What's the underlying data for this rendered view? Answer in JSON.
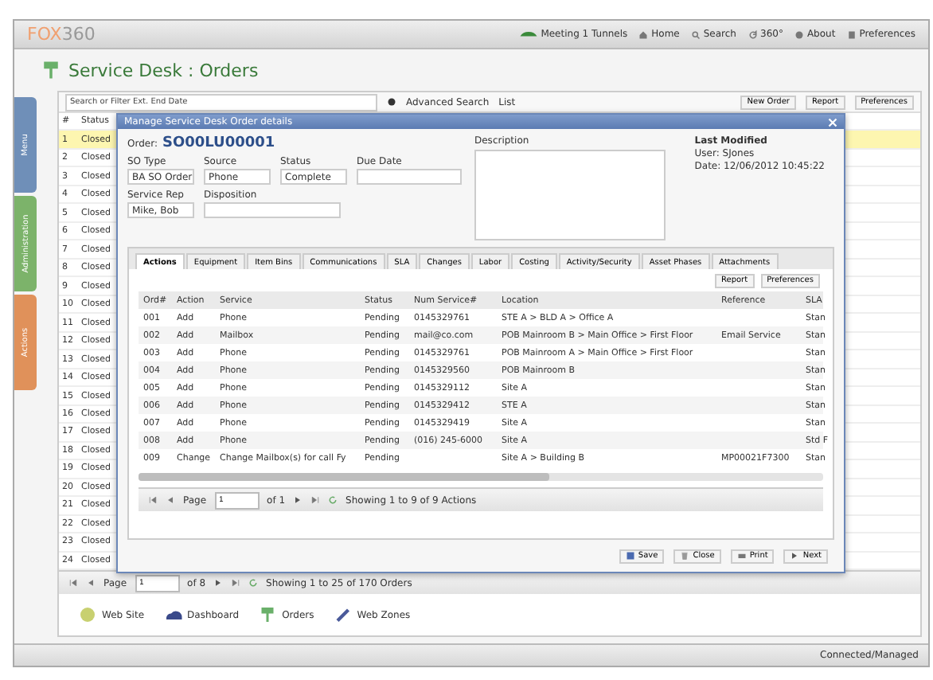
{
  "app": {
    "logo_a": "FOX",
    "logo_b": "360",
    "nav": [
      {
        "label": "Meeting 1 Tunnels"
      },
      {
        "label": "Home"
      },
      {
        "label": "Search"
      },
      {
        "label": "360°"
      },
      {
        "label": "About"
      },
      {
        "label": "Preferences"
      }
    ]
  },
  "page_title": "Service Desk : Orders",
  "side_tabs": [
    {
      "label": "Menu",
      "color": "#6f8fb8"
    },
    {
      "label": "Administration",
      "color": "#7cb36a"
    },
    {
      "label": "Actions",
      "color": "#e0915a"
    }
  ],
  "search": {
    "placeholder": "Search or Filter Ext. End Date",
    "advanced": "Advanced Search",
    "list": "List",
    "buttons": [
      "New Order",
      "Report",
      "Preferences"
    ]
  },
  "list": {
    "columns": [
      "#",
      "Status"
    ],
    "rows": [
      {
        "num": "1",
        "status": "Closed",
        "selected": true
      },
      {
        "num": "2",
        "status": "Closed",
        "selected": false
      },
      {
        "num": "3",
        "status": "Closed",
        "selected": false
      },
      {
        "num": "4",
        "status": "Closed",
        "selected": false
      },
      {
        "num": "5",
        "status": "Closed",
        "selected": false
      },
      {
        "num": "6",
        "status": "Closed",
        "selected": false
      },
      {
        "num": "7",
        "status": "Closed",
        "selected": false
      },
      {
        "num": "8",
        "status": "Closed",
        "selected": false
      },
      {
        "num": "9",
        "status": "Closed",
        "selected": false
      },
      {
        "num": "10",
        "status": "Closed",
        "selected": false
      },
      {
        "num": "11",
        "status": "Closed",
        "selected": false
      },
      {
        "num": "12",
        "status": "Closed",
        "selected": false
      },
      {
        "num": "13",
        "status": "Closed",
        "selected": false
      },
      {
        "num": "14",
        "status": "Closed",
        "selected": false
      },
      {
        "num": "15",
        "status": "Closed",
        "selected": false
      },
      {
        "num": "16",
        "status": "Closed",
        "selected": false
      },
      {
        "num": "17",
        "status": "Closed",
        "selected": false
      },
      {
        "num": "18",
        "status": "Closed",
        "selected": false
      },
      {
        "num": "19",
        "status": "Closed",
        "selected": false
      },
      {
        "num": "20",
        "status": "Closed",
        "selected": false
      },
      {
        "num": "21",
        "status": "Closed",
        "selected": false
      },
      {
        "num": "22",
        "status": "Closed",
        "selected": false
      },
      {
        "num": "23",
        "status": "Closed",
        "selected": false
      },
      {
        "num": "24",
        "status": "Closed",
        "selected": false
      }
    ],
    "pager": {
      "page_label": "Page",
      "page": "1",
      "of": "of 8",
      "info": "Showing 1 to 25 of 170 Orders"
    }
  },
  "shortcuts": [
    {
      "label": "Web Site"
    },
    {
      "label": "Dashboard"
    },
    {
      "label": "Orders"
    },
    {
      "label": "Web Zones"
    }
  ],
  "dialog": {
    "title": "Manage Service Desk Order details",
    "order_label": "Order:",
    "order_number": "SO00LU00001",
    "fields": [
      {
        "label": "SO Type",
        "value": "BA SO Order"
      },
      {
        "label": "Source",
        "value": "Phone"
      },
      {
        "label": "Status",
        "value": "Complete"
      },
      {
        "label": "Due Date"
      }
    ],
    "rep": {
      "label": "Service Rep",
      "value": "Mike, Bob"
    },
    "disposition": "Disposition",
    "description": "Description",
    "modified": {
      "title": "Last Modified",
      "user": "User: SJones",
      "date": "Date: 12/06/2012 10:45:22"
    },
    "tabs": [
      {
        "label": "Actions",
        "selected": true
      },
      {
        "label": "Equipment",
        "selected": false
      },
      {
        "label": "Item Bins",
        "selected": false
      },
      {
        "label": "Communications",
        "selected": false
      },
      {
        "label": "SLA",
        "selected": false
      },
      {
        "label": "Changes",
        "selected": false
      },
      {
        "label": "Labor",
        "selected": false
      },
      {
        "label": "Costing",
        "selected": false
      },
      {
        "label": "Activity/Security",
        "selected": false
      },
      {
        "label": "Asset Phases",
        "selected": false
      },
      {
        "label": "Attachments",
        "selected": false
      }
    ],
    "tools": [
      "Report",
      "Preferences"
    ],
    "table": {
      "columns": [
        "Ord#",
        "Action",
        "Service",
        "Status",
        "Num Service#",
        "Location",
        "Reference",
        "SLA"
      ],
      "rows": [
        [
          "001",
          "Add",
          "Phone",
          "Pending",
          "0145329761",
          "STE A > BLD A > Office A",
          "",
          "Stan"
        ],
        [
          "002",
          "Add",
          "Mailbox",
          "Pending",
          "mail@co.com",
          "POB Mainroom B > Main Office > First Floor",
          "Email Service",
          "Stan"
        ],
        [
          "003",
          "Add",
          "Phone",
          "Pending",
          "0145329761",
          "POB Mainroom A > Main Office > First Floor",
          "",
          "Stan"
        ],
        [
          "004",
          "Add",
          "Phone",
          "Pending",
          "0145329560",
          "POB Mainroom B",
          "",
          "Stan"
        ],
        [
          "005",
          "Add",
          "Phone",
          "Pending",
          "0145329112",
          "Site A",
          "",
          "Stan"
        ],
        [
          "006",
          "Add",
          "Phone",
          "Pending",
          "0145329412",
          "STE A",
          "",
          "Stan"
        ],
        [
          "007",
          "Add",
          "Phone",
          "Pending",
          "0145329419",
          "Site A",
          "",
          "Stan"
        ],
        [
          "008",
          "Add",
          "Phone",
          "Pending",
          "(016) 245-6000",
          "Site A",
          "",
          "Std F"
        ],
        [
          "009",
          "Change",
          "Change Mailbox(s) for call Fy",
          "Pending",
          "",
          "Site A > Building B",
          "MP00021F7300",
          "Stan"
        ]
      ]
    },
    "pager": {
      "page_label": "Page",
      "page": "1",
      "of": "of 1",
      "info": "Showing 1 to 9 of 9 Actions"
    },
    "buttons": [
      {
        "label": "Save"
      },
      {
        "label": "Close"
      },
      {
        "label": "Print"
      },
      {
        "label": "Next"
      }
    ]
  },
  "status_bar": "Connected/Managed"
}
